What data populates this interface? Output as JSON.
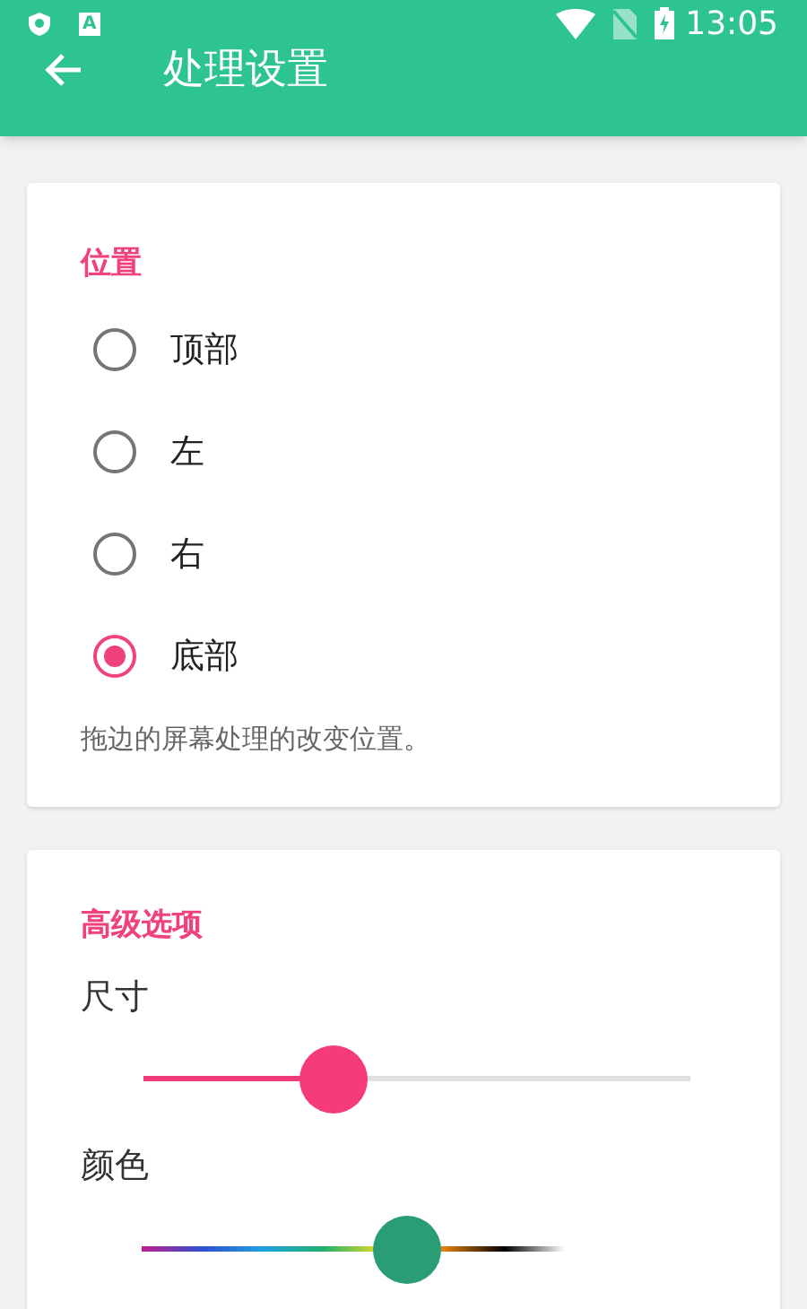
{
  "status_bar": {
    "notification_letter": "A",
    "time": "13:05"
  },
  "app_bar": {
    "title": "处理设置"
  },
  "position": {
    "title": "位置",
    "options": [
      {
        "label": "顶部",
        "selected": false
      },
      {
        "label": "左",
        "selected": false
      },
      {
        "label": "右",
        "selected": false
      },
      {
        "label": "底部",
        "selected": true
      }
    ],
    "hint": "拖边的屏幕处理的改变位置。"
  },
  "advanced": {
    "title": "高级选项",
    "sliders": [
      {
        "kind": "size",
        "label": "尺寸",
        "level": 0.33
      },
      {
        "kind": "color",
        "label": "颜色",
        "level": 0.46
      }
    ]
  }
}
